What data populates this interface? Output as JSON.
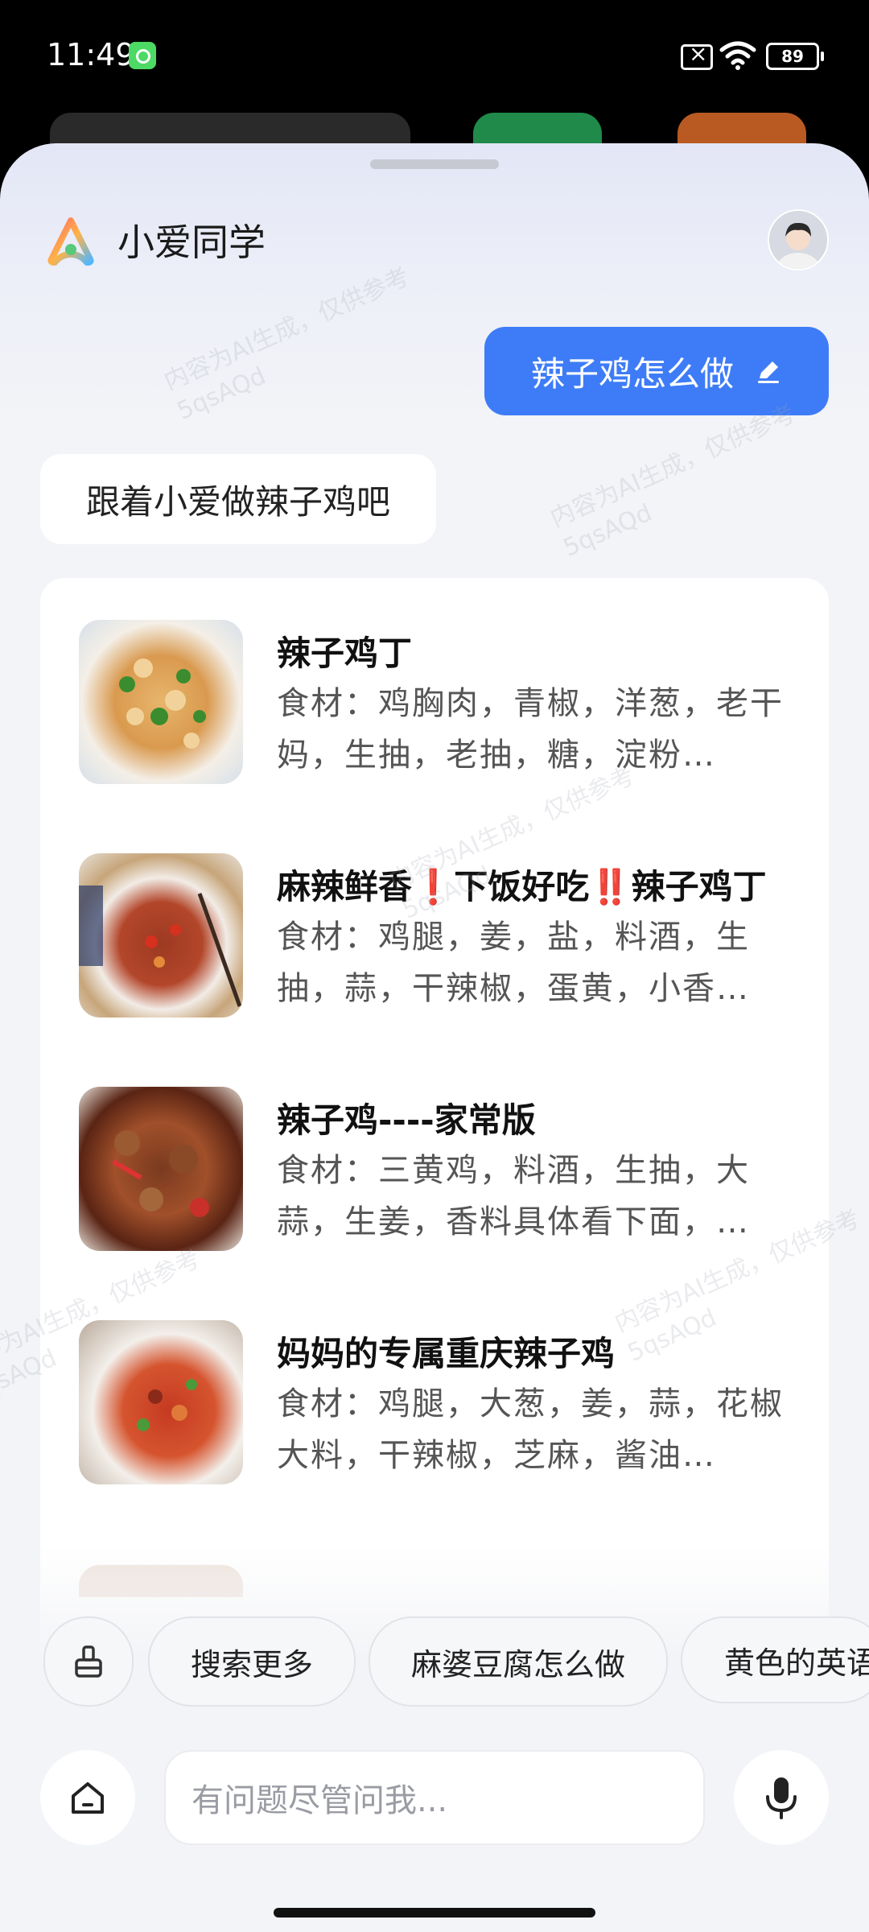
{
  "status_bar": {
    "time": "11:49",
    "battery": "89"
  },
  "assistant": {
    "name": "小爱同学"
  },
  "conversation": {
    "user_message": "辣子鸡怎么做",
    "ai_reply": "跟着小爱做辣子鸡吧"
  },
  "recipes": [
    {
      "title": "辣子鸡丁",
      "description": "食材：鸡胸肉，青椒，洋葱，老干妈，生抽，老抽，糖，淀粉…"
    },
    {
      "title": "麻辣鲜香❗下饭好吃‼️辣子鸡丁",
      "description": "食材：鸡腿，姜，盐，料酒，生抽，蒜，干辣椒，蛋黄，小香…"
    },
    {
      "title": "辣子鸡----家常版",
      "description": "食材：三黄鸡，料酒，生抽，大蒜，生姜，香料具体看下面，…"
    },
    {
      "title": "妈妈的专属重庆辣子鸡",
      "description": "食材：鸡腿，大葱，姜，蒜，花椒大料，干辣椒，芝麻，酱油…"
    }
  ],
  "suggestions": [
    "搜索更多",
    "麻婆豆腐怎么做",
    "黄色的英语"
  ],
  "input": {
    "placeholder": "有问题尽管问我..."
  },
  "watermark": {
    "line1": "内容为AI生成，仅供参考",
    "line2": "5qsAQd"
  },
  "colors": {
    "accent": "#3e7cf7",
    "background": "#f3f4f7"
  }
}
